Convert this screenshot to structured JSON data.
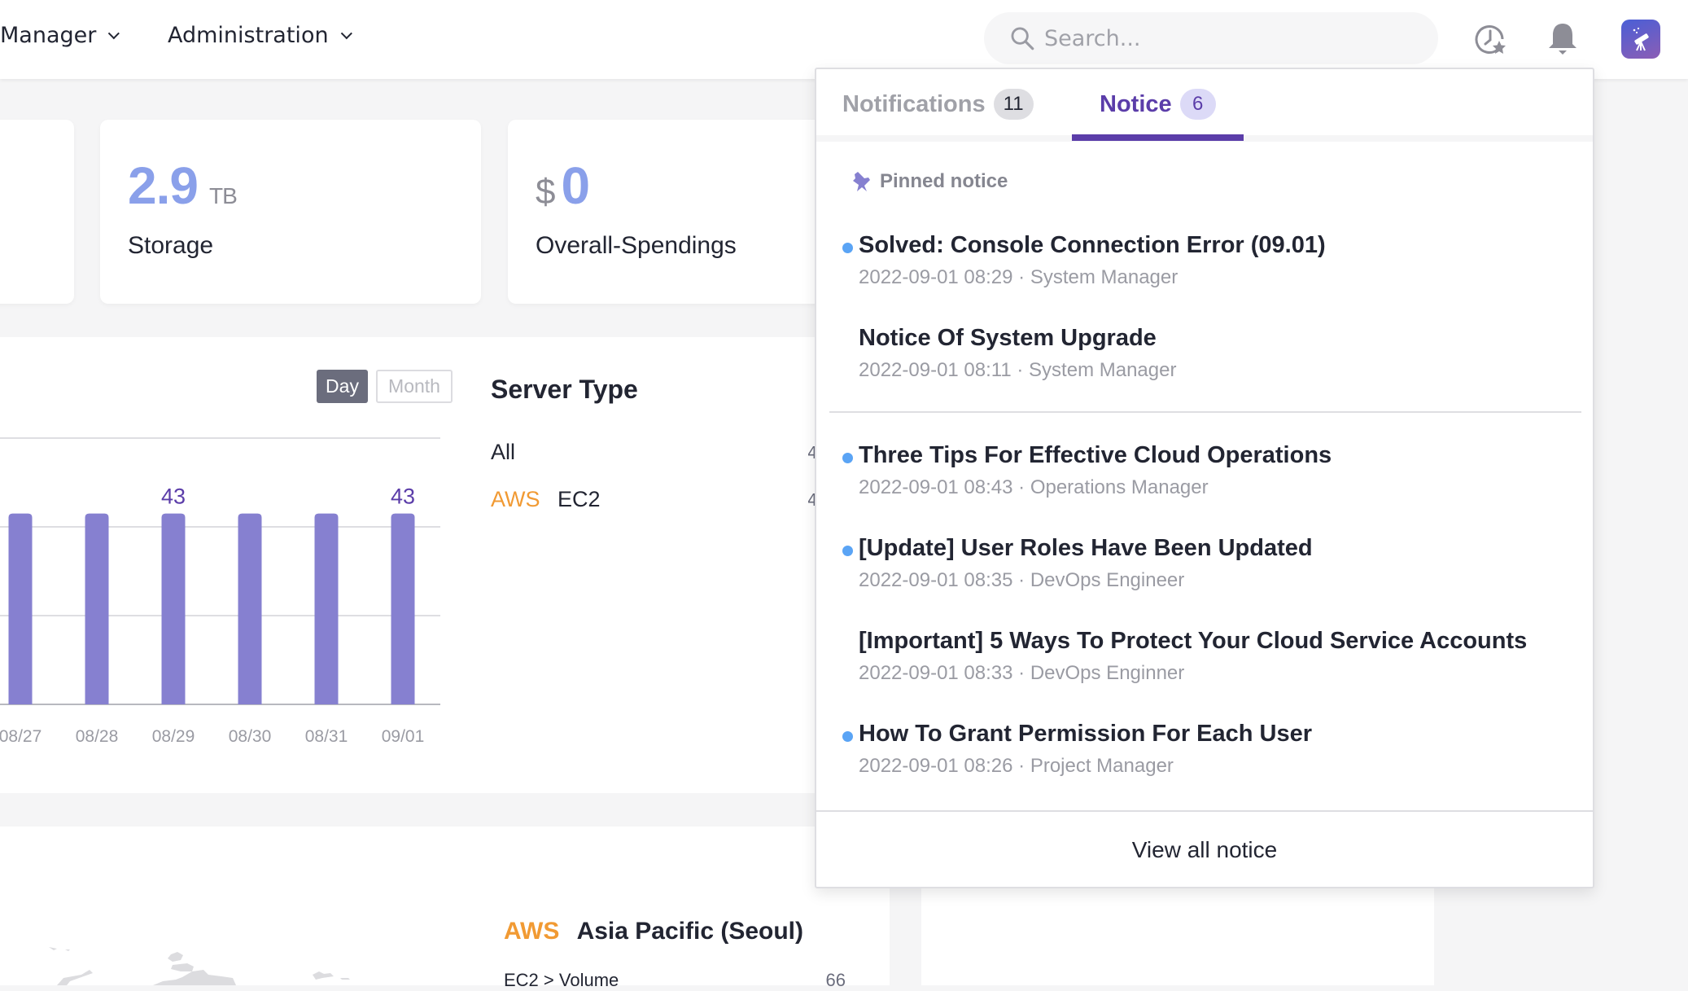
{
  "header": {
    "nav": [
      {
        "label": "Manager",
        "icon": "chevron-down-icon"
      },
      {
        "label": "Administration",
        "icon": "chevron-down-icon"
      }
    ],
    "search": {
      "placeholder": "Search...",
      "value": "",
      "icon": "search-icon"
    },
    "icons": [
      "history-star-icon",
      "bell-icon",
      "telescope-avatar-icon"
    ]
  },
  "summary_cards": [
    {
      "value": "2.9",
      "unit": "TB",
      "label": "Storage"
    },
    {
      "currency": "$",
      "value": "0",
      "label": "Overall-Spendings"
    }
  ],
  "colors": {
    "accent": "#5b3da9",
    "bar": "#8680d0",
    "metric_value": "#8aa0ea",
    "aws": "#f19a33",
    "unread_dot": "#5aa4f5"
  },
  "chart_toggle": {
    "options": [
      "Day",
      "Month"
    ],
    "selected": "Day"
  },
  "chart_data": {
    "type": "bar",
    "title": "",
    "xlabel": "",
    "ylabel": "",
    "categories": [
      "08/27",
      "08/28",
      "08/29",
      "08/30",
      "08/31",
      "09/01"
    ],
    "values": [
      43,
      43,
      43,
      43,
      43,
      43
    ],
    "data_labels": {
      "08/29": "43",
      "09/01": "43"
    },
    "ylim": [
      0,
      60
    ],
    "gridlines": [
      0,
      20,
      40,
      60
    ],
    "grid": true
  },
  "server_type": {
    "title": "Server Type",
    "rows": [
      {
        "provider": "",
        "name": "All",
        "value": "4"
      },
      {
        "provider": "AWS",
        "name": "EC2",
        "value": "4"
      }
    ]
  },
  "region": {
    "provider": "AWS",
    "name": "Asia Pacific (Seoul)",
    "rows": [
      {
        "label": "EC2 > Volume",
        "value": "66"
      }
    ]
  },
  "dropdown": {
    "tabs": [
      {
        "label": "Notifications",
        "count": "11",
        "active": false
      },
      {
        "label": "Notice",
        "count": "6",
        "active": true
      }
    ],
    "pinned_label": "Pinned notice",
    "pinned": [
      {
        "title": "Solved: Console Connection Error (09.01)",
        "meta": "2022-09-01 08:29 · System Manager",
        "unread": true
      },
      {
        "title": "Notice Of System Upgrade",
        "meta": "2022-09-01 08:11 · System Manager",
        "unread": false
      }
    ],
    "items": [
      {
        "title": "Three Tips For Effective Cloud Operations",
        "meta": "2022-09-01 08:43 · Operations Manager",
        "unread": true
      },
      {
        "title": "[Update] User Roles Have Been Updated",
        "meta": "2022-09-01 08:35 · DevOps Engineer",
        "unread": true
      },
      {
        "title": "[Important] 5 Ways To Protect Your Cloud Service Accounts",
        "meta": "2022-09-01 08:33 · DevOps Enginner",
        "unread": false
      },
      {
        "title": "How To Grant Permission For Each User",
        "meta": "2022-09-01 08:26 · Project Manager",
        "unread": true
      }
    ],
    "view_all_label": "View all notice"
  }
}
